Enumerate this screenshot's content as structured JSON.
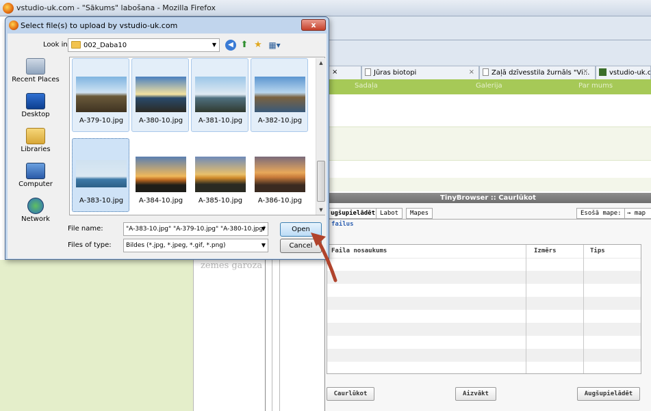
{
  "firefox": {
    "window_title": "vstudio-uk.com - \"Sākums\" labošana - Mozilla Firefox",
    "tabs": [
      {
        "label": "×"
      },
      {
        "label": "Jūras biotopi"
      },
      {
        "label": "Zaļā dzīvesstila žurnāls \"Vi..."
      },
      {
        "label": "vstudio-uk.com"
      }
    ],
    "tab_close": "×",
    "site_nav": [
      "Sadaļa",
      "Galerija",
      "Par mums"
    ],
    "page_text": "zemes garoza"
  },
  "tinybrowser": {
    "title": "TinyBrowser :: Caurlūkot",
    "tabs": [
      "ugšupielādēt",
      "Labot",
      "Mapes"
    ],
    "existing_folders_label": "Esošā mape:",
    "existing_folders_value": "→ map",
    "legend": "failus",
    "columns": [
      "Faila nosaukums",
      "Izmērs",
      "Tips"
    ],
    "buttons": {
      "browse": "Caurlūkot",
      "close": "Aizvākt",
      "upload": "Augšupielādēt"
    }
  },
  "dialog": {
    "title": "Select file(s) to upload by vstudio-uk.com",
    "close_label": "x",
    "look_in_label": "Look in:",
    "look_in_value": "002_Daba10",
    "places": [
      {
        "label": "Recent Places",
        "icon": "recent-places-icon"
      },
      {
        "label": "Desktop",
        "icon": "desktop-icon"
      },
      {
        "label": "Libraries",
        "icon": "libraries-icon"
      },
      {
        "label": "Computer",
        "icon": "computer-icon"
      },
      {
        "label": "Network",
        "icon": "network-icon"
      }
    ],
    "files": [
      {
        "name": "A-379-10.jpg",
        "state": "highlighted"
      },
      {
        "name": "A-380-10.jpg",
        "state": "highlighted"
      },
      {
        "name": "A-381-10.jpg",
        "state": "highlighted"
      },
      {
        "name": "A-382-10.jpg",
        "state": "highlighted"
      },
      {
        "name": "A-383-10.jpg",
        "state": "focused"
      },
      {
        "name": "A-384-10.jpg",
        "state": "normal"
      },
      {
        "name": "A-385-10.jpg",
        "state": "normal"
      },
      {
        "name": "A-386-10.jpg",
        "state": "normal"
      }
    ],
    "file_name_label": "File name:",
    "file_name_value": "\"A-383-10.jpg\" \"A-379-10.jpg\" \"A-380-10.jpg\" '",
    "file_type_label": "Files of type:",
    "file_type_value": "Bildes (*.jpg, *.jpeg, *.gif, *.png)",
    "open_label": "Open",
    "cancel_label": "Cancel"
  },
  "colors": {
    "dialog_frame": "#c1d5ed",
    "site_nav_green": "#a6c957",
    "annotation_arrow": "#b0432c"
  }
}
